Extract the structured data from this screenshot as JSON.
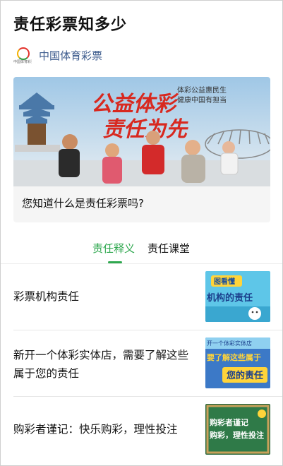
{
  "article": {
    "title": "责任彩票知多少"
  },
  "account": {
    "name": "中国体育彩票",
    "logo_caption": "中国体育彩票"
  },
  "feature_card": {
    "caption": "您知道什么是责任彩票吗?",
    "banner_headline_1": "公益体彩",
    "banner_headline_2": "责任为先",
    "banner_tag_1": "体彩公益惠民生",
    "banner_tag_2": "健康中国有担当"
  },
  "tabs": [
    {
      "label": "责任释义",
      "active": true
    },
    {
      "label": "责任课堂",
      "active": false
    }
  ],
  "list": [
    {
      "text": "彩票机构责任",
      "thumb_line1": "图看懂",
      "thumb_line2": "机构的责任"
    },
    {
      "text": "新开一个体彩实体店，需要了解这些属于您的责任",
      "thumb_line1": "开一个体彩实体店",
      "thumb_line2": "要了解这些属于",
      "thumb_line3": "您的责任"
    },
    {
      "text": "购彩者谨记：快乐购彩，理性投注",
      "thumb_line1": "购彩者谨记",
      "thumb_line2": "购彩，理性投注"
    }
  ],
  "colors": {
    "accent_green": "#2fa84f",
    "account_blue": "#3b5a8c",
    "banner_red": "#d8281f"
  }
}
